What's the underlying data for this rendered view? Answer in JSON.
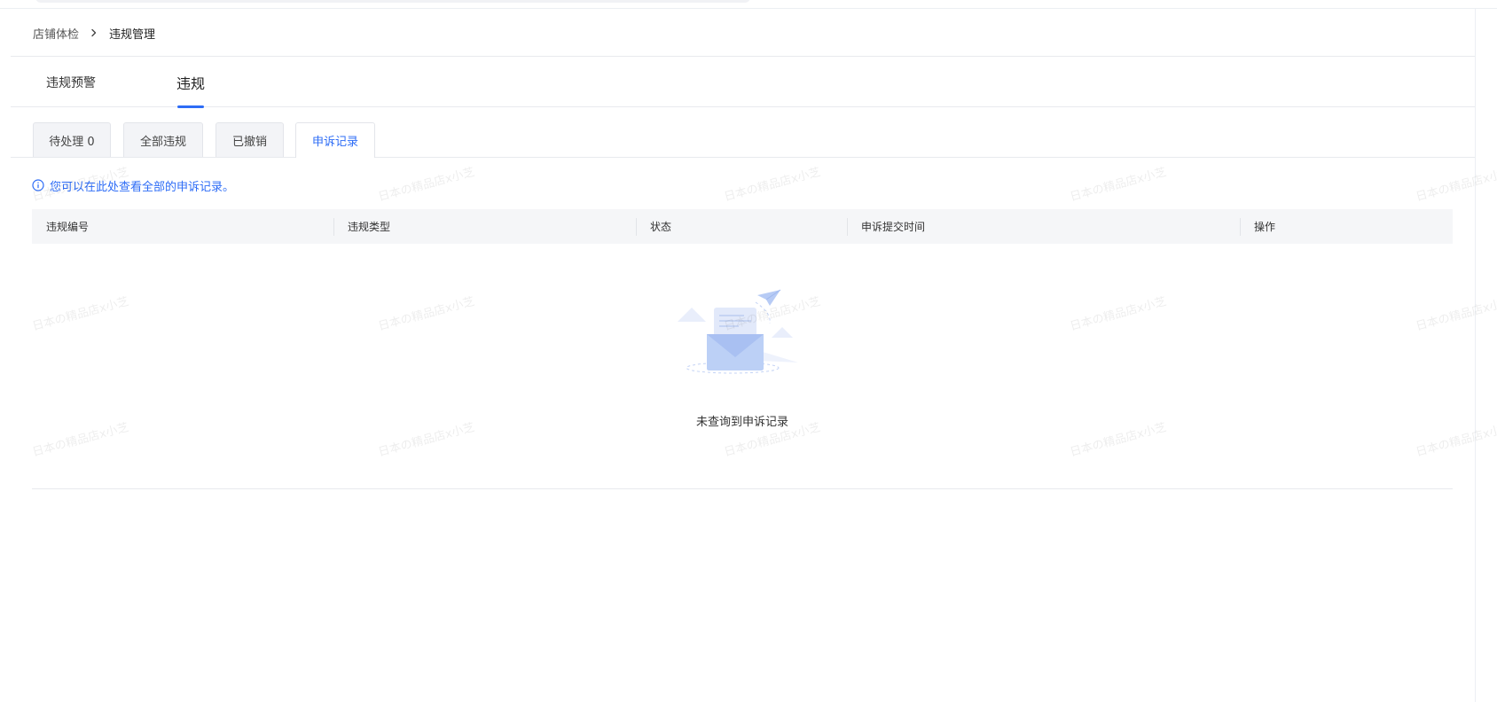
{
  "breadcrumb": {
    "parent": "店铺体检",
    "current": "违规管理"
  },
  "main_tabs": [
    {
      "label": "违规预警"
    },
    {
      "label": "违规"
    }
  ],
  "sub_tabs": [
    {
      "label": "待处理 0"
    },
    {
      "label": "全部违规"
    },
    {
      "label": "已撤销"
    },
    {
      "label": "申诉记录"
    }
  ],
  "tip": {
    "text": "您可以在此处查看全部的申诉记录。"
  },
  "table": {
    "columns": [
      "违规编号",
      "违规类型",
      "状态",
      "申诉提交时间",
      "操作"
    ]
  },
  "empty": {
    "text": "未查询到申诉记录"
  },
  "watermark": {
    "text": "日本の精品店x小芝"
  },
  "colors": {
    "accent": "#2d6cf6",
    "header_bg": "#f5f6f8",
    "tab_bg": "#f3f4f7"
  }
}
